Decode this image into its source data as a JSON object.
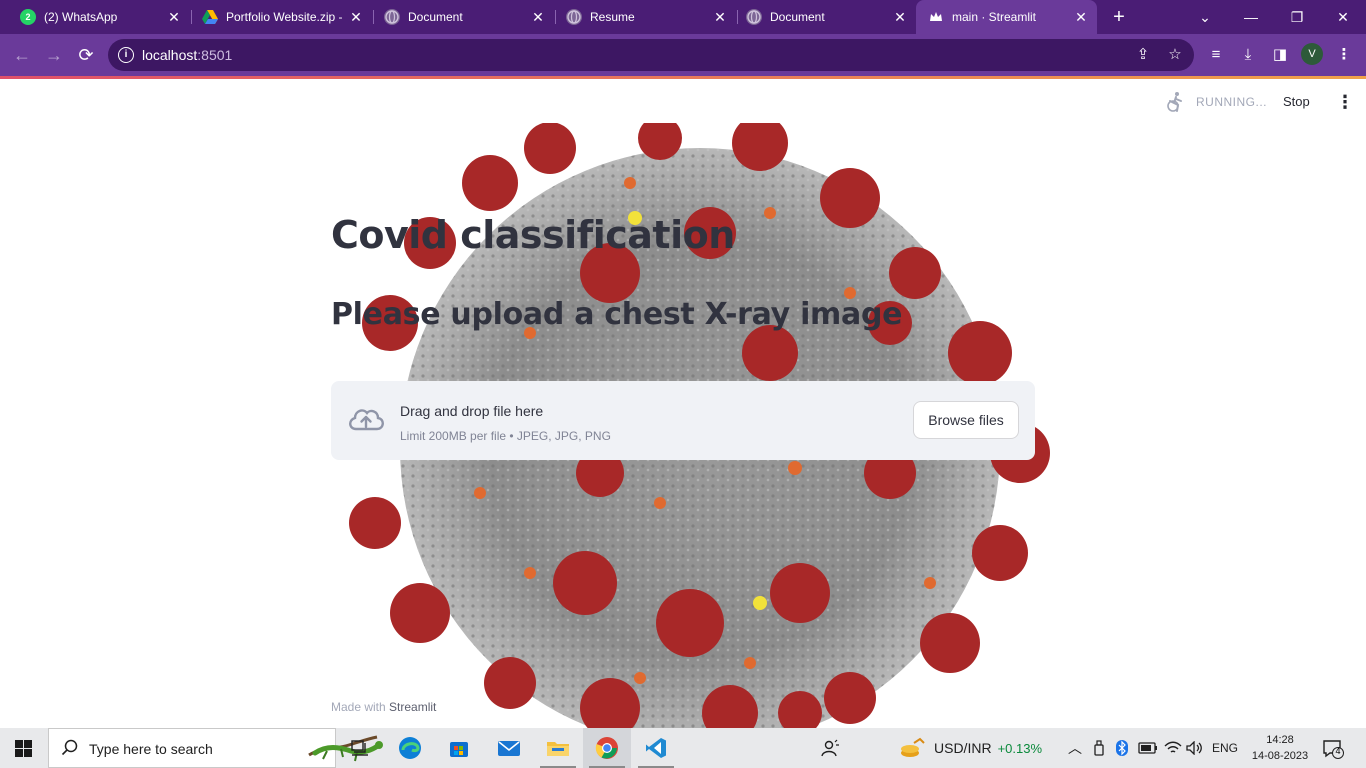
{
  "browser": {
    "tabs": [
      {
        "title": "(2) WhatsApp",
        "icon": "whatsapp-icon"
      },
      {
        "title": "Portfolio Website.zip -",
        "icon": "google-drive-icon"
      },
      {
        "title": "Document",
        "icon": "globe-icon"
      },
      {
        "title": "Resume",
        "icon": "globe-icon"
      },
      {
        "title": "Document",
        "icon": "globe-icon"
      },
      {
        "title": "main · Streamlit",
        "icon": "streamlit-crown-icon",
        "active": true
      }
    ],
    "new_tab": "+",
    "address": {
      "host": "localhost",
      "port": ":8501"
    },
    "profile_initial": "V",
    "colors": {
      "tabbar": "#4a1d75",
      "toolbar": "#6a3a9a"
    }
  },
  "streamlit": {
    "status": "RUNNING...",
    "stop_label": "Stop",
    "title": "Covid classification",
    "subtitle": "Please upload a chest X-ray image",
    "uploader": {
      "drag_text": "Drag and drop file here",
      "limit_text": "Limit 200MB per file • JPEG, JPG, PNG",
      "browse_label": "Browse files"
    },
    "footer": {
      "prefix": "Made with ",
      "brand": "Streamlit"
    }
  },
  "taskbar": {
    "search_placeholder": "Type here to search",
    "apps": [
      "task-view-icon",
      "edge-icon",
      "store-icon",
      "mail-icon",
      "file-explorer-icon",
      "chrome-icon",
      "vscode-icon"
    ],
    "ticker": {
      "symbol": "USD/INR",
      "change": "+0.13%"
    },
    "language": "ENG",
    "time": "14:28",
    "date": "14-08-2023",
    "notifications": "4"
  }
}
